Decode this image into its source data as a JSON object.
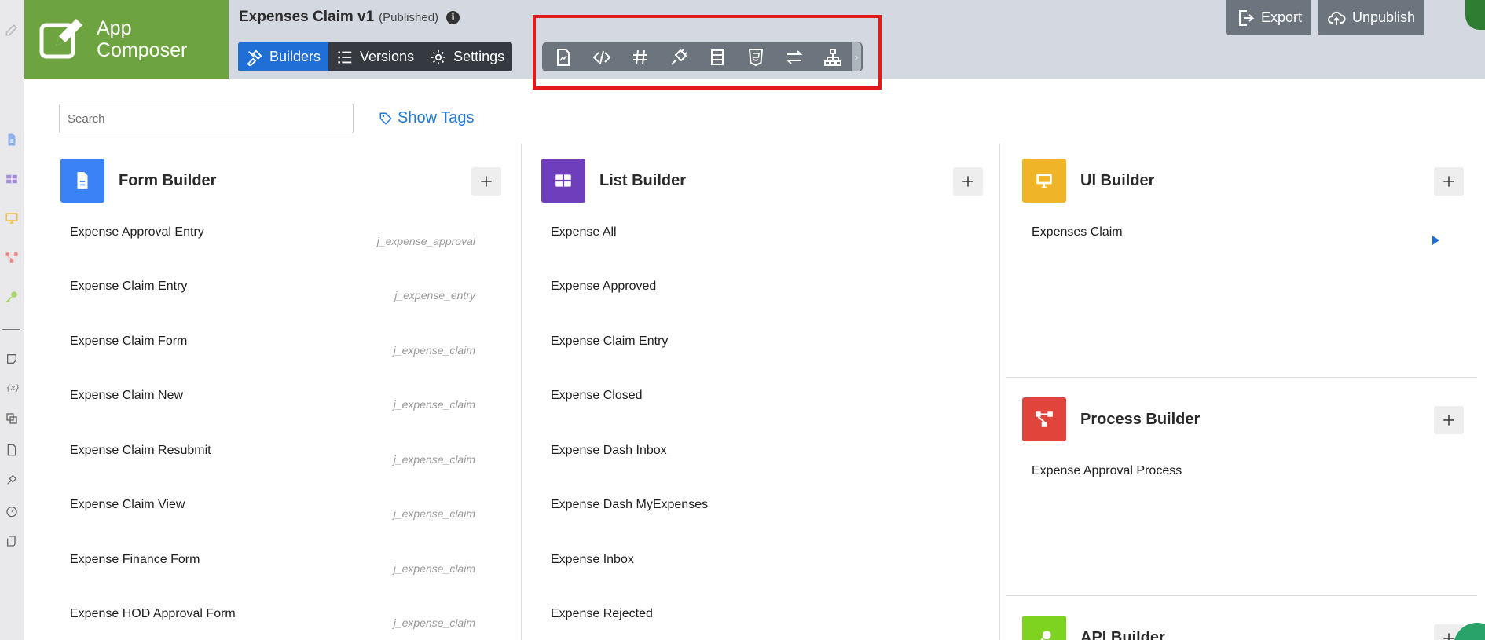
{
  "app": {
    "brand": "App Composer",
    "title": "Expenses Claim v1",
    "status": "(Published)",
    "info_glyph": "i",
    "accent": "#1f6fd6",
    "brand_color": "#6da43f"
  },
  "nav_tabs": [
    {
      "label": "Builders",
      "icon": "builders-icon",
      "active": true
    },
    {
      "label": "Versions",
      "icon": "list-icon",
      "active": false
    },
    {
      "label": "Settings",
      "icon": "gear-icon",
      "active": false
    }
  ],
  "toolbar_icons": [
    "report-icon",
    "code-icon",
    "hash-icon",
    "plugin-icon",
    "table-icon",
    "html5-icon",
    "swap-icon",
    "sitemap-icon"
  ],
  "header_buttons": {
    "export": "Export",
    "unpublish": "Unpublish"
  },
  "search": {
    "placeholder": "Search"
  },
  "show_tags": "Show Tags",
  "builders": {
    "form": {
      "title": "Form Builder",
      "color": "#3b82f6",
      "items": [
        {
          "name": "Expense Approval Entry",
          "table": "j_expense_approval"
        },
        {
          "name": "Expense Claim Entry",
          "table": "j_expense_entry"
        },
        {
          "name": "Expense Claim Form",
          "table": "j_expense_claim"
        },
        {
          "name": "Expense Claim New",
          "table": "j_expense_claim"
        },
        {
          "name": "Expense Claim Resubmit",
          "table": "j_expense_claim"
        },
        {
          "name": "Expense Claim View",
          "table": "j_expense_claim"
        },
        {
          "name": "Expense Finance Form",
          "table": "j_expense_claim"
        },
        {
          "name": "Expense HOD Approval Form",
          "table": "j_expense_claim"
        }
      ]
    },
    "list": {
      "title": "List Builder",
      "color": "#6f3ebd",
      "items": [
        "Expense All",
        "Expense Approved",
        "Expense Claim Entry",
        "Expense Closed",
        "Expense Dash Inbox",
        "Expense Dash MyExpenses",
        "Expense Inbox",
        "Expense Rejected"
      ]
    },
    "ui": {
      "title": "UI Builder",
      "color": "#f0b429",
      "items": [
        "Expenses Claim"
      ]
    },
    "process": {
      "title": "Process Builder",
      "color": "#e0443a",
      "items": [
        "Expense Approval Process"
      ]
    },
    "api": {
      "title": "API Builder",
      "color": "#7ed321"
    }
  }
}
